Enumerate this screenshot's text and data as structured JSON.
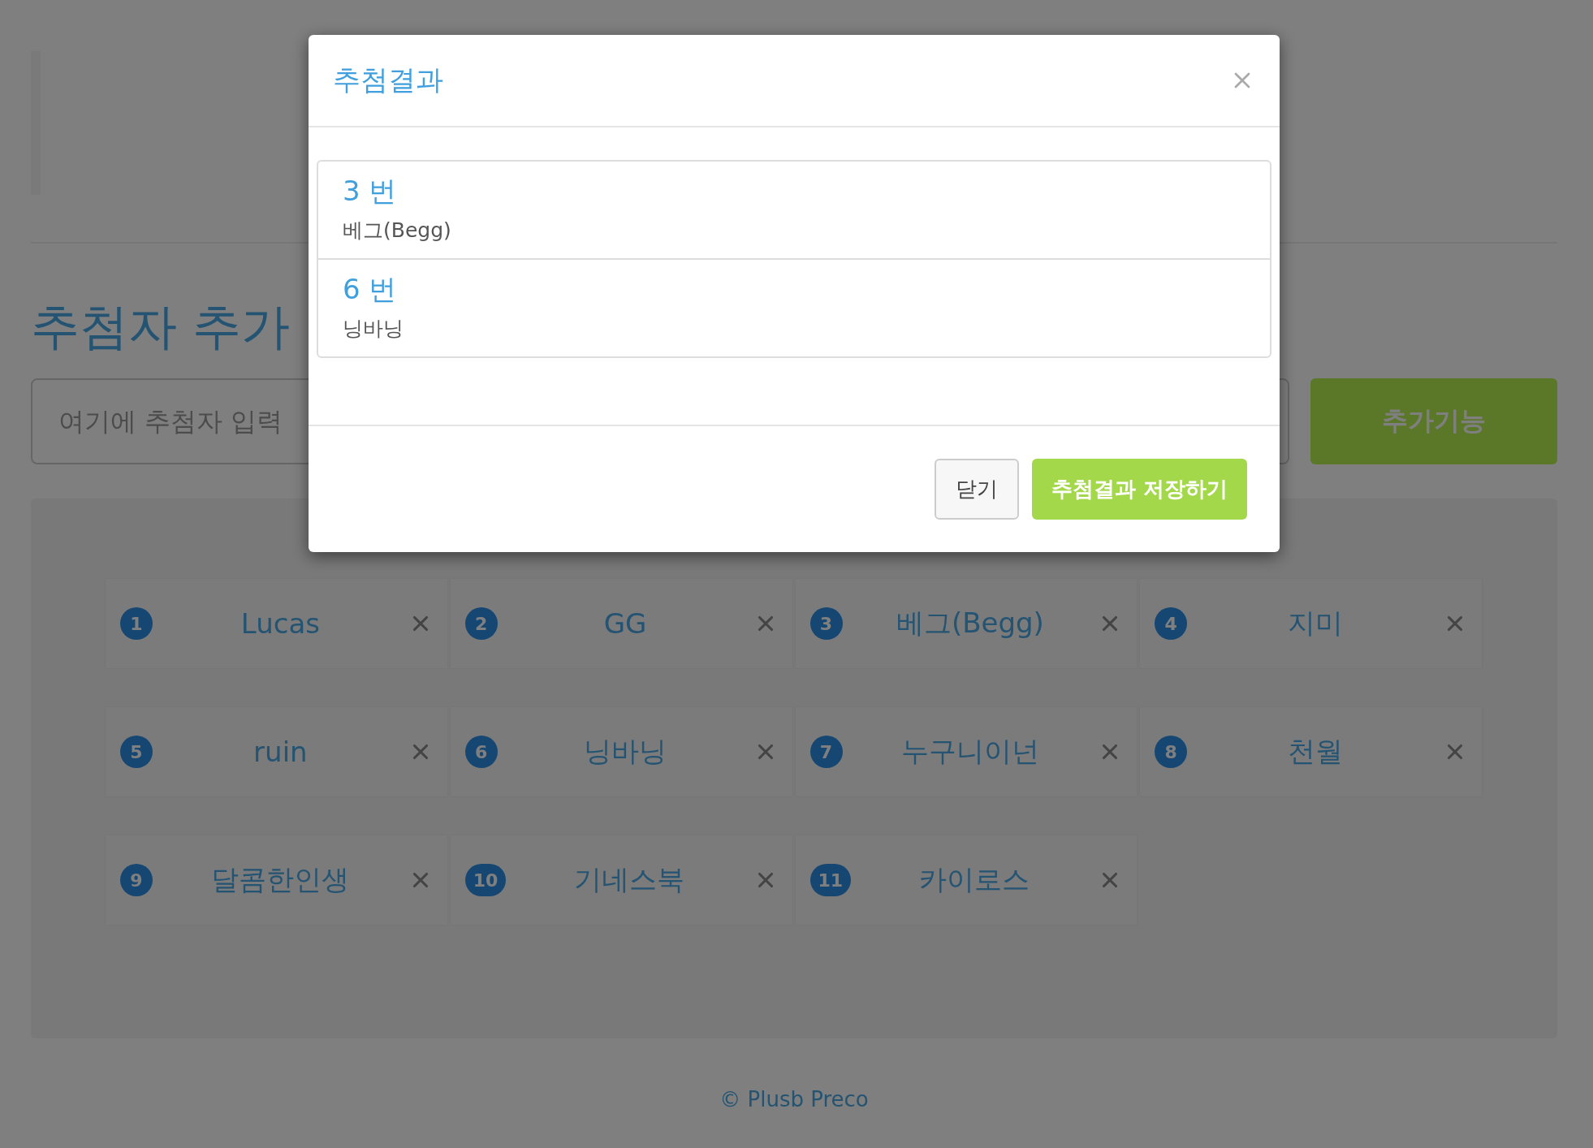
{
  "page": {
    "heading": "추첨자 추가",
    "input": {
      "placeholder": "여기에 추첨자 입력"
    },
    "add_button": "추가기능",
    "participants": [
      {
        "number": "1",
        "name": "Lucas"
      },
      {
        "number": "2",
        "name": "GG"
      },
      {
        "number": "3",
        "name": "베그(Begg)"
      },
      {
        "number": "4",
        "name": "지미"
      },
      {
        "number": "5",
        "name": "ruin"
      },
      {
        "number": "6",
        "name": "닝바닝"
      },
      {
        "number": "7",
        "name": "누구니이넌"
      },
      {
        "number": "8",
        "name": "천월"
      },
      {
        "number": "9",
        "name": "달콤한인생"
      },
      {
        "number": "10",
        "name": "기네스북"
      },
      {
        "number": "11",
        "name": "카이로스"
      }
    ],
    "footer": "© Plusb Preco"
  },
  "modal": {
    "title": "추첨결과",
    "results": [
      {
        "number": "3 번",
        "name": "베그(Begg)"
      },
      {
        "number": "6 번",
        "name": "닝바닝"
      }
    ],
    "buttons": [
      {
        "label": "닫기",
        "kind": "secondary"
      },
      {
        "label": "추첨결과 저장하기",
        "kind": "primary"
      }
    ]
  }
}
